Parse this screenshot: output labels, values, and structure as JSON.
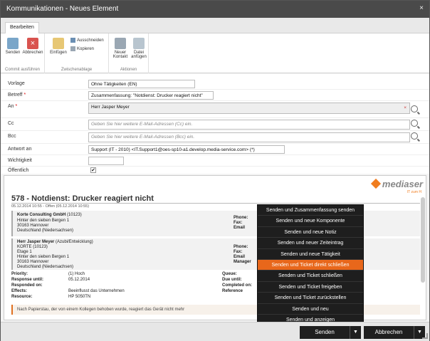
{
  "window": {
    "title": "Kommunikationen - Neues Element",
    "close": "×"
  },
  "ribbon": {
    "tab": "Bearbeiten",
    "groups": [
      {
        "label": "Commit ausführen",
        "buttons": [
          "Senden",
          "Abbrechen"
        ]
      },
      {
        "label": "Zwischenablage",
        "buttons": [
          "Einfügen"
        ],
        "small": [
          "Ausschneiden",
          "Kopieren"
        ]
      },
      {
        "label": "Aktionen",
        "buttons": [
          "Neuer Kontakt",
          "Datei anfügen"
        ]
      }
    ]
  },
  "form": {
    "vorlage": {
      "label": "Vorlage",
      "value": "Ohne Tätigkeiten (EN)"
    },
    "betreff": {
      "label": "Betreff",
      "value": "Zusammenfassung: \"Notdienst: Drucker reagiert nicht\""
    },
    "an": {
      "label": "An",
      "value": "Herr Jasper Meyer"
    },
    "cc": {
      "label": "Cc",
      "placeholder": "Geben Sie hier weitere E-Mail-Adressen (Cc) ein."
    },
    "bcc": {
      "label": "Bcc",
      "placeholder": "Geben Sie hier weitere E-Mail-Adressen (Bcc) ein."
    },
    "antwort": {
      "label": "Antwort an",
      "value": "Support (IT - 2010) <IT.Support1@oes-sp10-a1.develop.media-service.com> (*)"
    },
    "wichtigkeit": {
      "label": "Wichtigkeit",
      "value": ""
    },
    "oeffentlich": {
      "label": "Öffentlich",
      "checked": "✔"
    }
  },
  "preview": {
    "logo": "mediaser",
    "logo_sub": "IT zum H",
    "title": "578 - Notdienst: Drucker reagiert nicht",
    "subtitle": "05.12.2014 10:55 - Offen (05.12.2014 10:55)",
    "company": {
      "name": "Korte Consulting GmbH",
      "id": "(10123)",
      "street": "Hinter den sieben Bergen 1",
      "city": "30163 Hannover",
      "region": "Deutschland (Niedersachsen)",
      "labels": [
        "Phone:",
        "Fax:",
        "Email"
      ]
    },
    "contact": {
      "name": "Herr Jasper Meyer",
      "role": "(Azubi/Entwicklung)",
      "company": "KORTE (10123)",
      "floor": "Etage 1",
      "street": "Hinter den sieben Bergen 1",
      "city": "30163 Hannover",
      "region": "Deutschland (Niedersachsen)",
      "labels": [
        "Phone:",
        "Fax:",
        "Email",
        "Manager"
      ]
    },
    "meta": [
      {
        "k": "Priority:",
        "v": "(1) Hoch",
        "k2": "Queue:"
      },
      {
        "k": "Response until:",
        "v": "05.12.2014",
        "k2": "Due until:"
      },
      {
        "k": "Responded on:",
        "v": "",
        "k2": "Completed on:"
      },
      {
        "k": "Effects:",
        "v": "Beeinflusst das Unternehmen",
        "k2": "Reference"
      },
      {
        "k": "Resource:",
        "v": "HP 5050TN",
        "k2": ""
      }
    ],
    "note": "Nach Papierstau, der von einem Kollegen behoben wurde, reagiert das Gerät nicht mehr"
  },
  "dropdown": {
    "items": [
      "Senden und Zusammenfassung senden",
      "Senden und neue Komponente",
      "Senden und neue Notiz",
      "Senden und neuer Zeiteintrag",
      "Senden und neue Tätigkeit",
      "Senden und Ticket direkt schließen",
      "Senden und Ticket schließen",
      "Senden und Ticket freigeben",
      "Senden und Ticket zurückstellen",
      "Senden und neu",
      "Senden und anzeigen"
    ],
    "active_index": 5
  },
  "footer": {
    "send": "Senden",
    "cancel": "Abbrechen",
    "caret": "▼"
  }
}
